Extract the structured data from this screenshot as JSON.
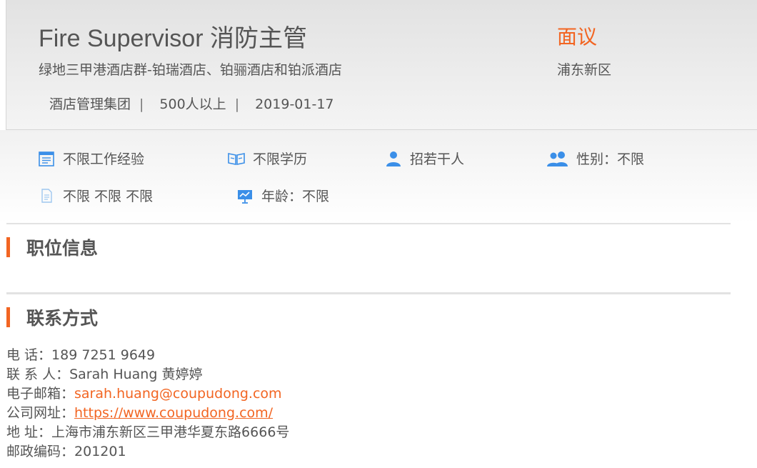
{
  "job": {
    "title": "Fire Supervisor 消防主管",
    "salary": "面议",
    "company": "绿地三甲港酒店群-铂瑞酒店、铂骊酒店和铂派酒店",
    "location": "浦东新区",
    "meta": {
      "industry": "酒店管理集团",
      "size": "500人以上",
      "date": "2019-01-17",
      "separator": "|"
    }
  },
  "requirements": {
    "experience": "不限工作经验",
    "education": "不限学历",
    "headcount": "招若干人",
    "gender": "性别：不限",
    "language": "不限 不限 不限",
    "age": "年龄：不限"
  },
  "sections": {
    "position_info": "职位信息",
    "contact": "联系方式"
  },
  "contact": {
    "phone_label": "电 话：",
    "phone": "189 7251 9649",
    "person_label": "联 系 人：",
    "person": "Sarah Huang 黄婷婷",
    "email_label": "电子邮箱：",
    "email": "sarah.huang@coupudong.com",
    "website_label": "公司网址：",
    "website": "https://www.coupudong.com/",
    "address_label": "地 址：",
    "address": "上海市浦东新区三甲港华夏东路6666号",
    "postcode_label": "邮政编码：",
    "postcode": "201201"
  },
  "colors": {
    "accent": "#f26522",
    "icon_blue": "#3b8fe8",
    "text": "#555555"
  },
  "icons": {
    "experience": "calendar-icon",
    "education": "book-icon",
    "headcount": "person-icon",
    "gender": "people-icon",
    "language": "document-icon",
    "age": "presentation-icon"
  }
}
